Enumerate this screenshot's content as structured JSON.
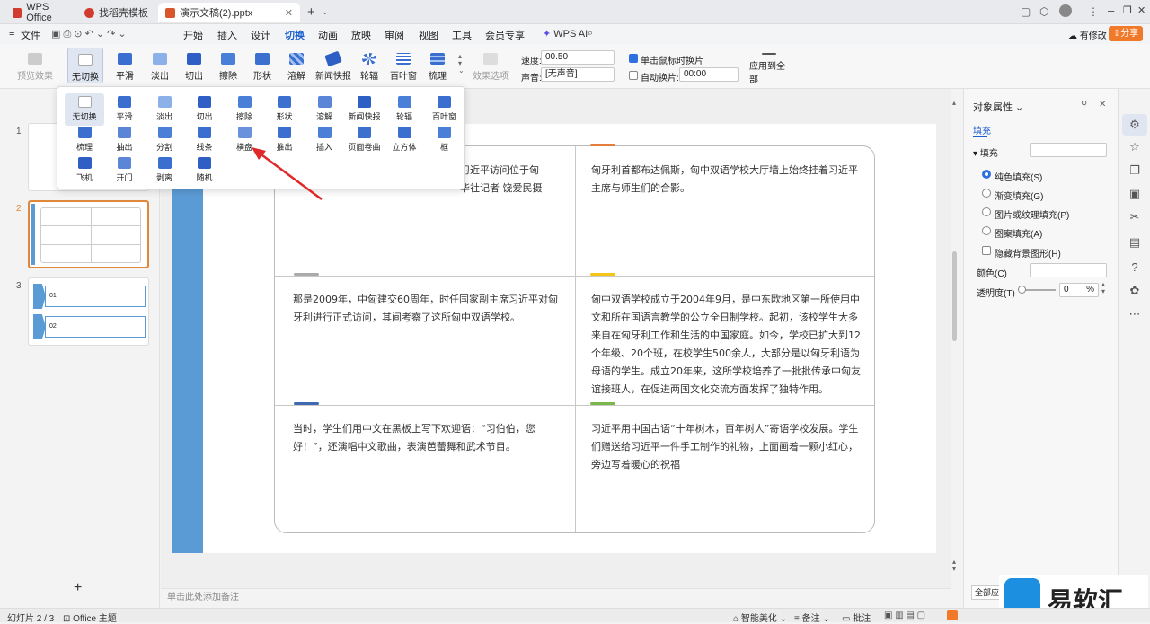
{
  "tabs": [
    {
      "label": "WPS Office",
      "color": "#d23b2f"
    },
    {
      "label": "找稻壳模板",
      "color": "#d23b2f"
    },
    {
      "label": "演示文稿(2).pptx",
      "color": "#d8562a"
    }
  ],
  "menu": {
    "file": "文件",
    "items": [
      "开始",
      "插入",
      "设计",
      "切换",
      "动画",
      "放映",
      "审阅",
      "视图",
      "工具",
      "会员专享"
    ],
    "selected": "切换",
    "wps_ai": "WPS AI",
    "has_changes": "有修改",
    "share": "分享"
  },
  "ribbon": {
    "preview": "预览效果",
    "transitions": [
      "无切换",
      "平滑",
      "淡出",
      "切出",
      "擦除",
      "形状",
      "溶解",
      "新闻快报",
      "轮辐",
      "百叶窗",
      "梳理"
    ],
    "effect_options": "效果选项",
    "speed_label": "速度:",
    "speed_value": "00.50",
    "sound_label": "声音:",
    "sound_value": "[无声音]",
    "click_switch": "单击鼠标时换片",
    "auto_switch": "自动换片:",
    "auto_value": "00:00",
    "apply_all": "应用到全部"
  },
  "popup_items": [
    "无切换",
    "平滑",
    "淡出",
    "切出",
    "擦除",
    "形状",
    "溶解",
    "新闻快报",
    "轮辐",
    "百叶窗",
    "梳理",
    "抽出",
    "分割",
    "线条",
    "横盘",
    "推出",
    "插入",
    "页面卷曲",
    "立方体",
    "框",
    "飞机",
    "开门",
    "剥离",
    "随机"
  ],
  "thumbs": [
    "1",
    "2",
    "3"
  ],
  "thumb3": {
    "n1": "01",
    "n2": "02"
  },
  "slide": {
    "c1": "习近平访问位于匈\n华社记者 饶爱民摄",
    "c2": "匈牙利首都布达佩斯，匈中双语学校大厅墙上始终挂着习近平主席与师生们的合影。",
    "c3": "那是2009年，中匈建交60周年，时任国家副主席习近平对匈牙利进行正式访问，其间考察了这所匈中双语学校。",
    "c4": "匈中双语学校成立于2004年9月，是中东欧地区第一所使用中文和所在国语言教学的公立全日制学校。起初，该校学生大多来自在匈牙利工作和生活的中国家庭。如今，学校已扩大到12个年级、20个班，在校学生500余人，大部分是以匈牙利语为母语的学生。成立20年来，这所学校培养了一批批传承中匈友谊接班人，在促进两国文化交流方面发挥了独特作用。",
    "c5": "当时，学生们用中文在黑板上写下欢迎语：“习伯伯，您好！”，还演唱中文歌曲，表演芭蕾舞和武术节目。",
    "c6": "习近平用中国古语“十年树木，百年树人”寄语学校发展。学生们赠送给习近平一件手工制作的礼物，上面画着一颗小红心，旁边写着暖心的祝福"
  },
  "notes": "单击此处添加备注",
  "panel": {
    "title": "对象属性",
    "tab": "填充",
    "fill": "填充",
    "options": [
      "纯色填充(S)",
      "渐变填充(G)",
      "图片或纹理填充(P)",
      "图案填充(A)"
    ],
    "hide_bg": "隐藏背景图形(H)",
    "color_label": "颜色(C)",
    "transparency_label": "透明度(T)",
    "transparency_value": "0",
    "percent": "%",
    "apply_all": "全部应用"
  },
  "status": {
    "slide": "幻灯片 2 / 3",
    "theme": "Office 主题",
    "beautify": "智能美化",
    "notes": "备注",
    "comments": "批注"
  },
  "watermark": "易软汇",
  "colors": {
    "accent": "#1a5fd0",
    "slide_bar": "#5b9bd5",
    "orange": "#e0883a",
    "share": "#f07a2a"
  }
}
